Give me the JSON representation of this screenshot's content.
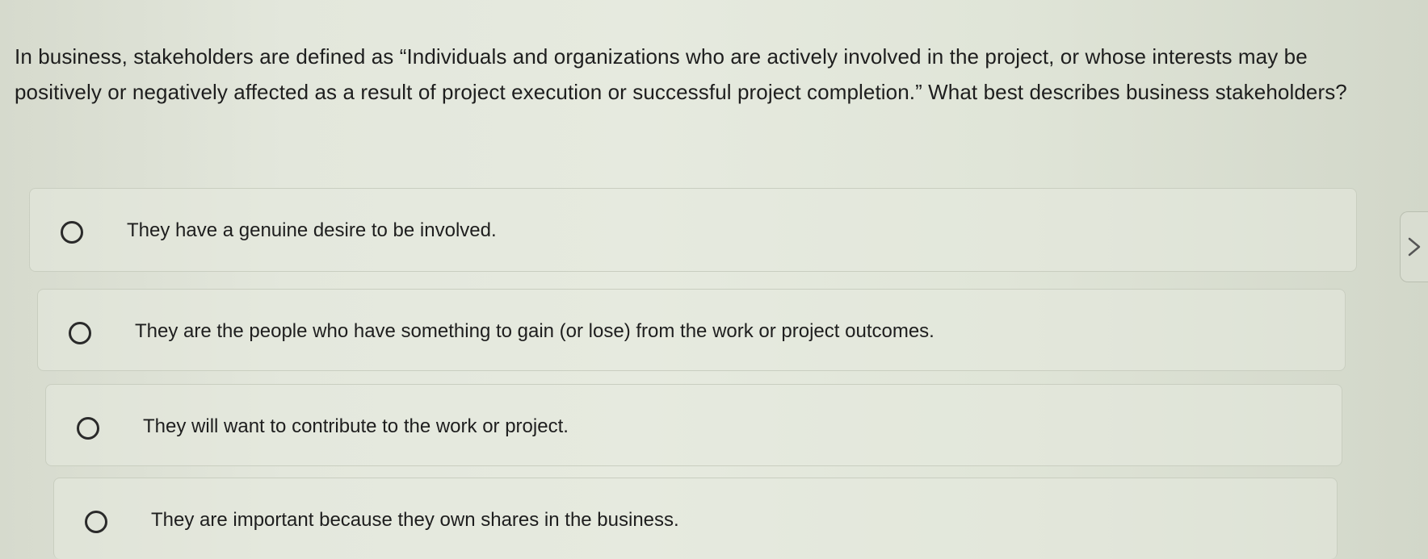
{
  "question": {
    "text": "In business, stakeholders are defined as “Individuals and organizations who are actively involved in the project, or whose interests may be positively or negatively affected as a result of project execution or successful project completion.” What best describes business stakeholders?"
  },
  "options": [
    {
      "label": "They have a genuine desire to be involved.",
      "selected": false
    },
    {
      "label": "They are the people who have something to gain (or lose) from the work or project outcomes.",
      "selected": false
    },
    {
      "label": "They will want to contribute to the work or project.",
      "selected": false
    },
    {
      "label": "They are important because they own shares in the business.",
      "selected": false
    }
  ],
  "navigation": {
    "next_icon": "chevron-right-icon"
  }
}
